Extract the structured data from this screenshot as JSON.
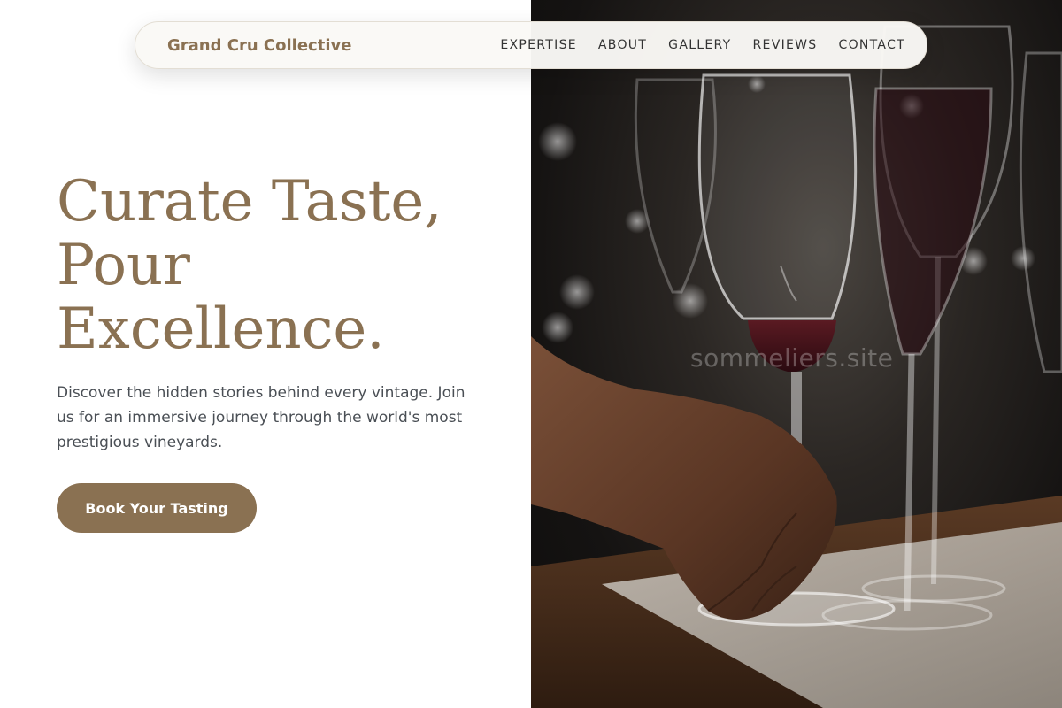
{
  "nav": {
    "brand": "Grand Cru Collective",
    "links": [
      "EXPERTISE",
      "ABOUT",
      "GALLERY",
      "REVIEWS",
      "CONTACT"
    ]
  },
  "hero": {
    "headline_lines": [
      "Curate Taste,",
      "Pour",
      "Excellence."
    ],
    "subtext": "Discover the hidden stories behind every vintage. Join us for an immersive journey through the world's most prestigious vineyards.",
    "cta_label": "Book Your Tasting",
    "image_watermark": "sommeliers.site"
  },
  "colors": {
    "accent": "#8a7152",
    "text_body": "#4a4f55",
    "nav_text": "#333333",
    "background": "#ffffff"
  }
}
